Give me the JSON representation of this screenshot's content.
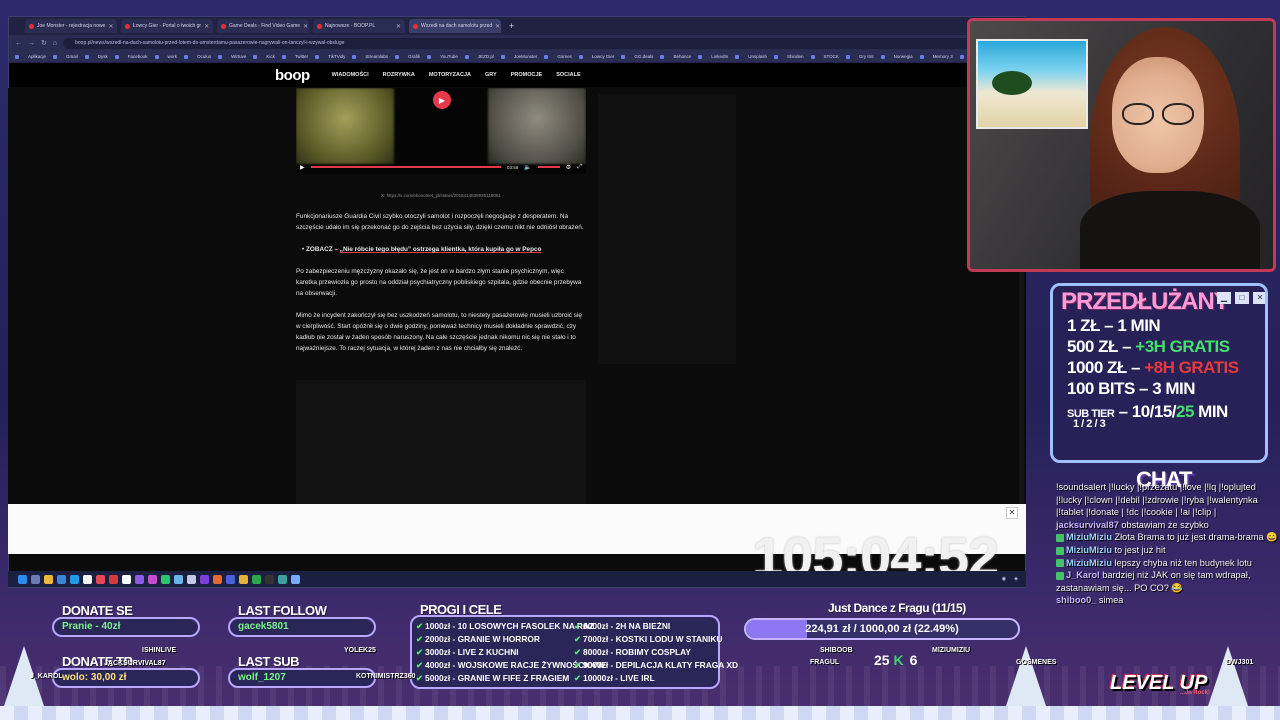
{
  "browser": {
    "tabs": [
      {
        "label": "Joe Monster - rejestracja nowe",
        "active": false
      },
      {
        "label": "Łowcy Gier - Portal o twoich gr",
        "active": false
      },
      {
        "label": "Game Deals - Find Video Game",
        "active": false
      },
      {
        "label": "Najnowsze - BOOP.PL",
        "active": false
      },
      {
        "label": "Wszedł na dach samolotu przed",
        "active": true
      }
    ],
    "url": "boop.pl/news/wszedl-na-dach-samolotu-przed-lotem-do-amsterdamu-pasazerowie-nagrywali-on-tanczyl-i-wzywal-obsluge",
    "bookmarks": [
      "Aplikacje",
      "Gmail",
      "Dysk",
      "Facebook",
      "work",
      "Oculus",
      "Wirtuve",
      "Kick",
      "Twitter",
      "TikTVidy",
      "Streamlabs",
      "Grafik",
      "YouTube",
      "JEZD.pl",
      "JoeMonster",
      "Games",
      "Łowcy Gier",
      "GG.deals",
      "Behance",
      "LinkedIn",
      "Unsplash",
      "Shinden",
      "STOCK",
      "Gry tmt",
      "Norwegia",
      "Memory 3",
      "Twitch",
      "wesele"
    ]
  },
  "site": {
    "logo": "boop",
    "nav": [
      "WIADOMOŚCI",
      "ROZRYWKA",
      "MOTORYZACJA",
      "GRY",
      "PROMOCJE",
      "SOCIALE"
    ]
  },
  "video": {
    "time": "03:58"
  },
  "article": {
    "source": "X: https://x.com/ekonomet_pl/status/2018414838935118061",
    "p1": "Funkcjonariusze Guardia Civil szybko otoczyli samolot i rozpoczęli negocjacje z desperatem. Na szczęście udało im się przekonać go do zejścia bez użycia siły, dzięki czemu nikt nie odniósł obrażeń.",
    "bullet_prefix": "ZOBACZ – ",
    "bullet_link": "„Nie róbcie tego błędu” ostrzega klientka, która kupiła go w Pepco",
    "p2": "Po zabezpieczeniu mężczyzny okazało się, że jest on w bardzo złym stanie psychicznym, więc karetka przewiozła go prosto na oddział psychiatryczny pobliskiego szpitala, gdzie obecnie przebywa na obserwacji.",
    "p3": "Mimo że incydent zakończył się bez uszkodzeń samolotu, to niestety pasażerowie musieli uzbroić się w cierpliwość. Start opóźnił się o dwie godziny, ponieważ technicy musieli dokładnie sprawdzić, czy kadłub nie został w żaden sposób naruszony. Na całe szczęście jednak nikomu nic się nie stało i to najważniejsze. To raczej sytuacja, w której żaden z nas nie chciałby się znaleźć."
  },
  "timer": "105:04:52",
  "promo": {
    "title": "PRZEDŁUŻANY",
    "rows": [
      {
        "left": "1 ZŁ",
        "right": "1 MIN",
        "style": ""
      },
      {
        "left": "500 ZŁ",
        "right": "+3H GRATIS",
        "style": "green"
      },
      {
        "left": "1000 ZŁ",
        "right": "+8H GRATIS",
        "style": "red"
      },
      {
        "left": "100 BITS",
        "right": "3 MIN",
        "style": ""
      }
    ],
    "subtier_label": "SUB TIER",
    "subtier_levels": "1 / 2 / 3",
    "subtier_values": "10/15/",
    "subtier_last": "25",
    "subtier_unit": "MIN"
  },
  "chat": {
    "title": "CHAT",
    "messages": [
      {
        "user": "",
        "text": "!soundsalert |!lucky |!przeżatu |!love |!lq |!oplujted |!lucky |!clown |!debil |!zdrowie |!ryba |!walentynka |!tablet |!donate | !dc |!cookie | !ai |!clip |"
      },
      {
        "user": "jacksurvival87",
        "text": "obstawiam że szybko"
      },
      {
        "user": "MiziuMiziu",
        "text": "Złota Brama to już jest drama-brama 😄"
      },
      {
        "user": "MiziuMiziu",
        "text": "to jest już hit"
      },
      {
        "user": "MiziuMiziu",
        "text": "lepszy chyba niż ten budynek lotu"
      },
      {
        "user": "J_Karol",
        "text": "bardziej niż JAK on się tam wdrapał, zastanawiam się... PO CO? 😂"
      },
      {
        "user": "shiboo0_",
        "text": "simea"
      }
    ]
  },
  "overlays": {
    "donate_label": "DONATE SE",
    "donate_value": "Pranie - 40zł",
    "donate_top_label": "DONATE TR",
    "donate_top_value": "wolo: 30,00 zł",
    "last_follow_label": "LAST FOLLOW",
    "last_follow_value": "gacek5801",
    "last_sub_label": "LAST SUB",
    "last_sub_value": "wolf_1207",
    "goals_label": "PROGI I CELE",
    "goals_left": [
      "1000zł - 10 LOSOWYCH FASOLEK NA RAZ",
      "2000zł - GRANIE W HORROR",
      "3000zł - LIVE Z KUCHNI",
      "4000zł - WOJSKOWE RACJE ŻYWNOŚCIOWE",
      "5000zł - GRANIE W FIFE Z FRAGIEM"
    ],
    "goals_right": [
      "6000zł - 2H NA BIEŻNI",
      "7000zł - KOSTKI LODU W STANIKU",
      "8000zł - ROBIMY COSPLAY",
      "9000zł - DEPILACJA KLATY FRAGA XD",
      "10000zł - LIVE IRL"
    ],
    "goal_title": "Just Dance z Fragu (11/15)",
    "goal_progress": "224,91 zł / 1000,00 zł (22.49%)",
    "goal_percent": 22.49,
    "score": "6",
    "score_left": "25",
    "names": [
      "ISHINLIVE",
      "JACKSURVIVAL87",
      "YOLEK25",
      "KOTNIMISTRZ360",
      "SHIBOOB",
      "FRAGUL",
      "MIZIUMIZIU",
      "GOSMENES",
      "J_KAROL",
      "DWJ301"
    ],
    "levelup": "LEVEL UP",
    "levelup_sub": "...Ja Rock!"
  }
}
